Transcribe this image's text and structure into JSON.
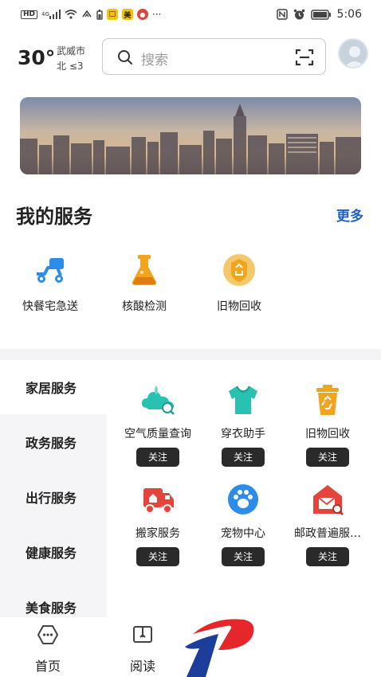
{
  "status_bar": {
    "left_icons": [
      "hd-icon",
      "signal-4g-icon",
      "wifi-icon",
      "hotspot-icon",
      "battery-saver-icon",
      "app-yellow-icon",
      "meituan-icon",
      "app-red-icon"
    ],
    "hd": "HD",
    "network": "4G",
    "meituan": "美",
    "overflow": "···",
    "time": "5:06"
  },
  "header": {
    "temperature": "30°",
    "city": "武威市",
    "wind": "北 ≤3",
    "search_placeholder": "搜索"
  },
  "my_services": {
    "title": "我的服务",
    "more": "更多",
    "items": [
      {
        "label": "快餐宅急送",
        "icon": "delivery-scooter-icon"
      },
      {
        "label": "核酸检测",
        "icon": "test-flask-icon"
      },
      {
        "label": "旧物回收",
        "icon": "recycle-badge-icon"
      }
    ]
  },
  "categories": [
    {
      "label": "家居服务"
    },
    {
      "label": "政务服务"
    },
    {
      "label": "出行服务"
    },
    {
      "label": "健康服务"
    },
    {
      "label": "美食服务"
    }
  ],
  "category_services": [
    {
      "label": "空气质量查询",
      "icon": "air-quality-icon",
      "button": "关注"
    },
    {
      "label": "穿衣助手",
      "icon": "tshirt-icon",
      "button": "关注"
    },
    {
      "label": "旧物回收",
      "icon": "recycle-bin-icon",
      "button": "关注"
    },
    {
      "label": "搬家服务",
      "icon": "moving-truck-icon",
      "button": "关注"
    },
    {
      "label": "宠物中心",
      "icon": "paw-icon",
      "button": "关注"
    },
    {
      "label": "邮政普遍服…",
      "icon": "post-house-icon",
      "button": "关注"
    }
  ],
  "bottom_nav": [
    {
      "label": "首页",
      "icon": "home-icon"
    },
    {
      "label": "阅读",
      "icon": "book-icon"
    }
  ],
  "colors": {
    "accent_link": "#1f5fc4",
    "teal": "#28c1b2",
    "orange": "#f2a41e",
    "red": "#e5443d",
    "blue": "#2d8ce8",
    "button_dark": "#2a2a2a"
  }
}
